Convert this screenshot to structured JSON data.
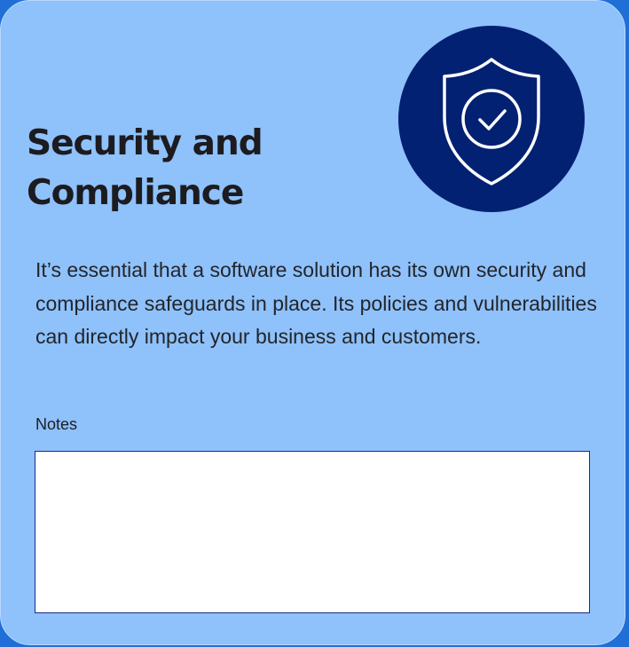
{
  "card": {
    "title": "Security and\nCompliance",
    "description": "It’s essential that a software solution has its own security and compliance safeguards in place. Its policies and vulnerabilities can directly impact your business and customers.",
    "icon": "shield-check-icon",
    "icon_background": "#032172",
    "card_background": "#8fc1fa"
  },
  "notes": {
    "label": "Notes",
    "value": ""
  }
}
